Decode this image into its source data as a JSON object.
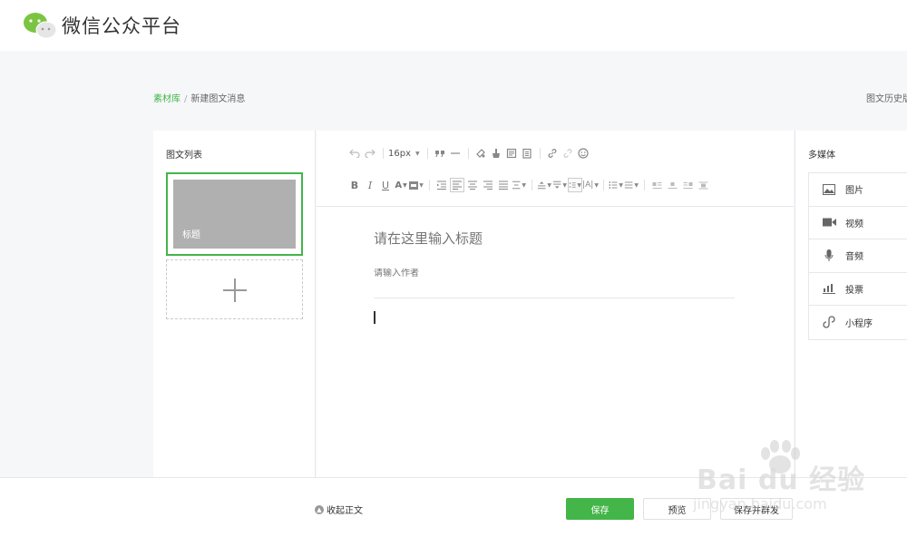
{
  "header": {
    "brand": "微信公众平台"
  },
  "breadcrumb": {
    "root": "素材库",
    "separator": "/",
    "current": "新建图文消息",
    "history_link": "图文历史版本"
  },
  "article_list": {
    "title": "图文列表",
    "items": [
      {
        "label": "标题"
      }
    ]
  },
  "editor": {
    "font_size": "16px",
    "title_placeholder": "请在这里输入标题",
    "author_placeholder": "请输入作者"
  },
  "media_panel": {
    "title": "多媒体",
    "items": [
      {
        "label": "图片",
        "icon": "image-icon"
      },
      {
        "label": "视频",
        "icon": "video-icon"
      },
      {
        "label": "音频",
        "icon": "microphone-icon"
      },
      {
        "label": "投票",
        "icon": "poll-icon"
      },
      {
        "label": "小程序",
        "icon": "mini-program-icon"
      }
    ]
  },
  "footer": {
    "collapse_label": "收起正文",
    "save_label": "保存",
    "preview_label": "预览",
    "publish_label": "保存并群发"
  },
  "watermark": {
    "text": "Bai du 经验",
    "url": "jingyan.baidu.com"
  },
  "colors": {
    "accent": "#44b549",
    "cover": "#b0b0b0"
  }
}
